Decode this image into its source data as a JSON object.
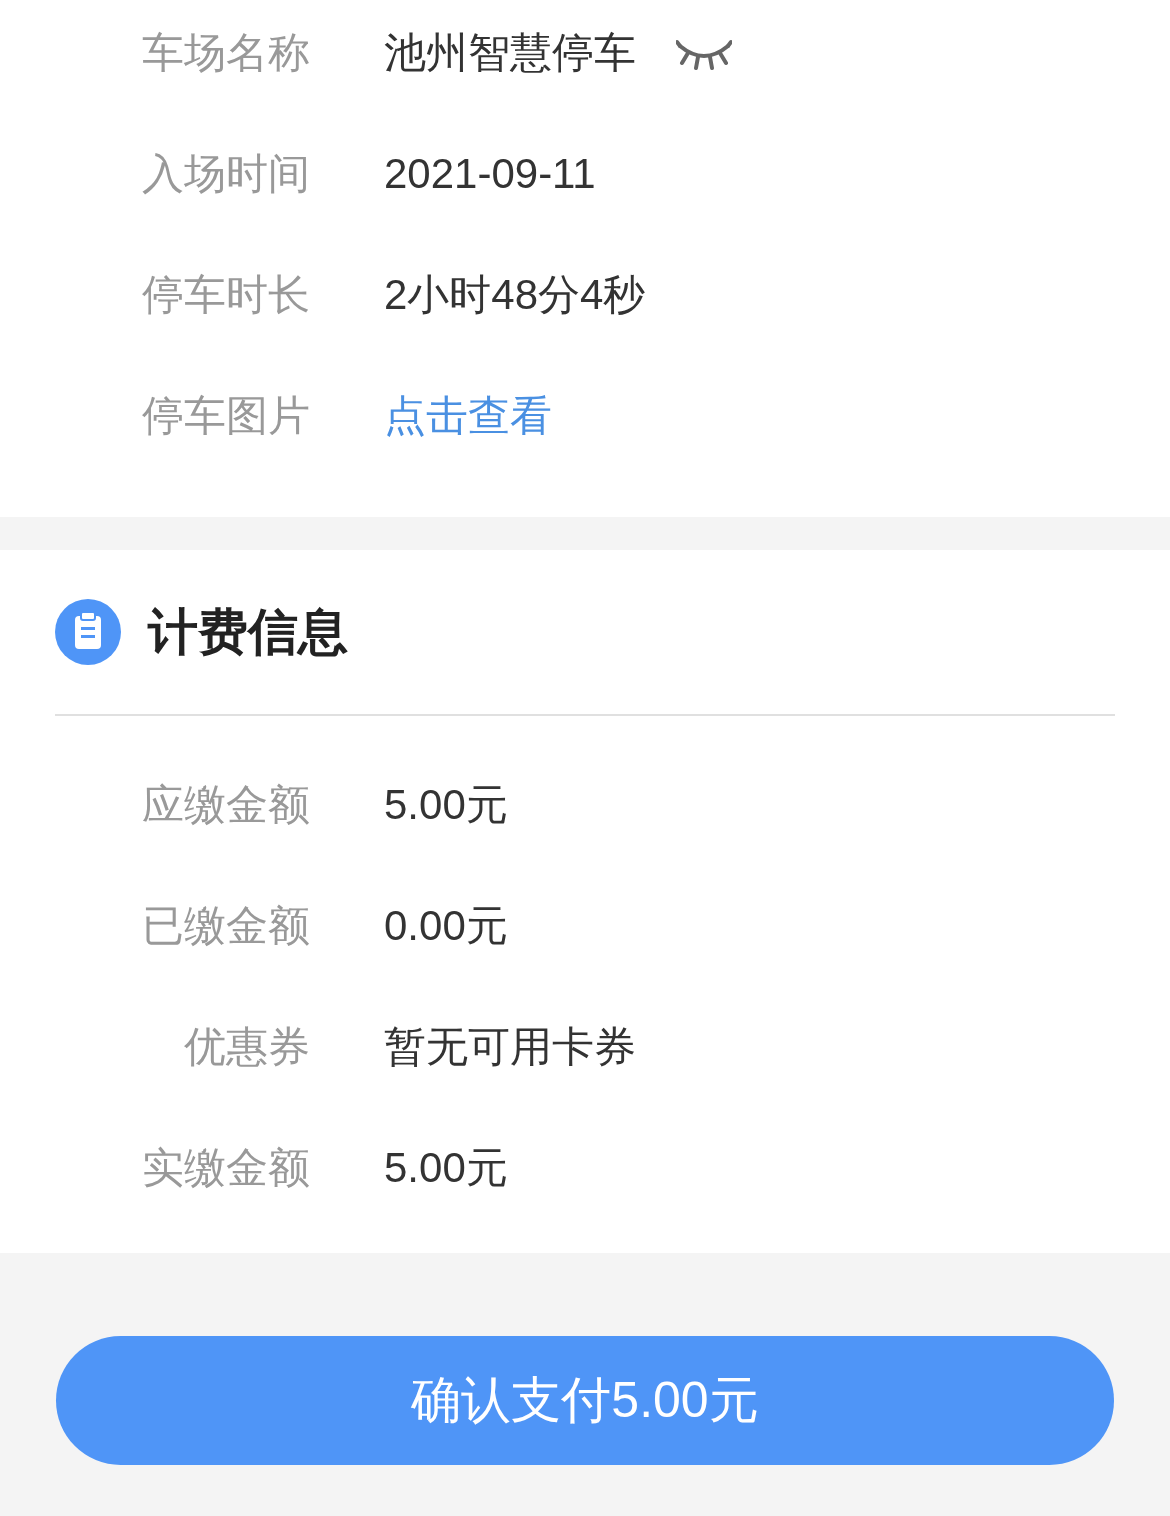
{
  "parking_info": {
    "rows": [
      {
        "label": "车场名称",
        "value": "池州智慧停车",
        "kind": "masked"
      },
      {
        "label": "入场时间",
        "value": "2021-09-11",
        "kind": "text"
      },
      {
        "label": "停车时长",
        "value": "2小时48分4秒",
        "kind": "text"
      },
      {
        "label": "停车图片",
        "value": "点击查看",
        "kind": "link"
      }
    ]
  },
  "billing_info": {
    "title": "计费信息",
    "rows": [
      {
        "label": "应缴金额",
        "value": "5.00元",
        "kind": "text"
      },
      {
        "label": "已缴金额",
        "value": "0.00元",
        "kind": "text"
      },
      {
        "label": "优惠券",
        "value": "暂无可用卡券",
        "kind": "text"
      },
      {
        "label": "实缴金额",
        "value": "5.00元",
        "kind": "text"
      }
    ]
  },
  "pay_button": "确认支付5.00元"
}
